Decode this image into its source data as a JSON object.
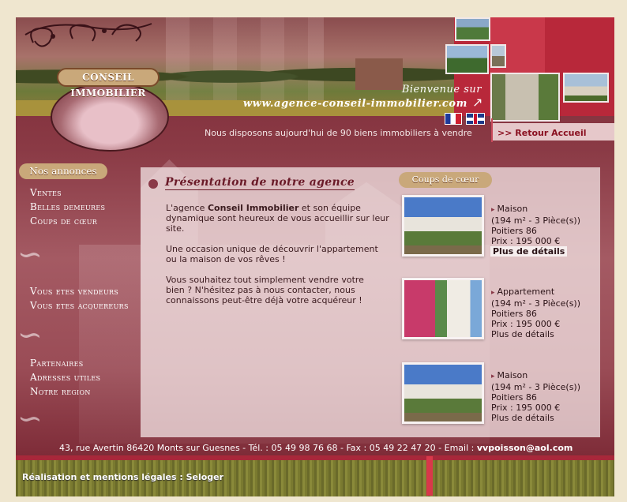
{
  "header": {
    "logo_text": "CONSEIL IMMOBILIER",
    "welcome": "Bienvenue sur",
    "site_url": "www.agence-conseil-immobilier.com",
    "tagline": "Nous disposons aujourd'hui de 90 biens immobiliers à vendre",
    "retour_label": ">> Retour Accueil",
    "flags": [
      "flag-fr-icon",
      "flag-uk-icon"
    ]
  },
  "nav": {
    "badge": "Nos annonces",
    "group1": [
      "Ventes",
      "Belles demeures",
      "Coups de cœur"
    ],
    "group2": [
      "Vous etes vendeurs",
      "Vous etes acquereurs"
    ],
    "group3": [
      "Partenaires",
      "Adresses utiles",
      "Notre region"
    ]
  },
  "content": {
    "title": "Présentation de notre agence",
    "p1_pre": "L'agence ",
    "p1_bold": "Conseil Immobilier",
    "p1_post": " et son équipe dynamique sont heureux de vous accueillir sur leur site.",
    "p2": "Une occasion unique de découvrir l'appartement ou la maison de vos rêves !",
    "p3": "Vous souhaitez tout simplement vendre votre bien ? N'hésitez pas à nous contacter, nous connaissons peut-être déjà votre acquéreur !"
  },
  "coups_de_coeur": {
    "badge": "Coups de cœur",
    "listings": [
      {
        "type": "Maison",
        "surface": "(194 m² - 3 Pièce(s))",
        "city": "Poitiers 86",
        "price": "Prix : 195 000 €",
        "details": "Plus de détails"
      },
      {
        "type": "Appartement",
        "surface": "(194 m² - 3 Pièce(s))",
        "city": "Poitiers 86",
        "price": "Prix : 195 000 €",
        "details": "Plus de détails"
      },
      {
        "type": "Maison",
        "surface": "(194 m² - 3 Pièce(s))",
        "city": "Poitiers 86",
        "price": "Prix : 195 000 €",
        "details": "Plus de détails"
      }
    ]
  },
  "footer": {
    "address": "43, rue Avertin 86420 Monts sur Guesnes - Tél. : 05 49 98 76 68 - Fax : 05 49 22 47 20 - Email : ",
    "email": "vvpoisson@aol.com",
    "credits": "Réalisation et mentions légales : Seloger"
  },
  "colors": {
    "maroon": "#7a2634",
    "accent_red": "#b8283a",
    "badge_tan": "#c9a87a",
    "link_dark_red": "#8a1020"
  }
}
